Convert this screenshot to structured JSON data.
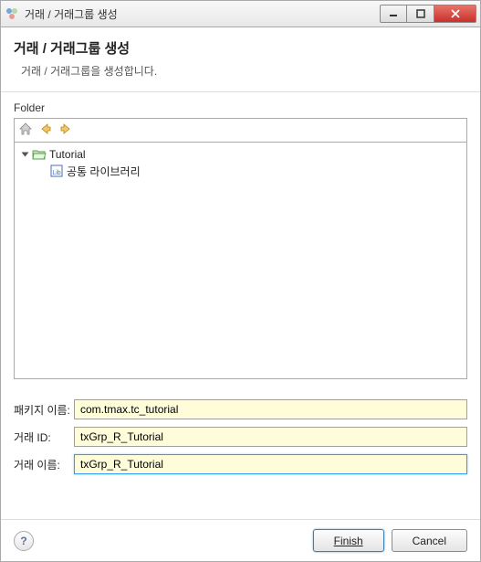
{
  "window": {
    "title": "거래 / 거래그룹 생성"
  },
  "header": {
    "title": "거래 / 거래그룹 생성",
    "subtitle": "거래 / 거래그룹을 생성합니다."
  },
  "folder": {
    "label": "Folder",
    "tree": [
      {
        "level": 0,
        "expanded": true,
        "icon": "folder-open",
        "label": "Tutorial"
      },
      {
        "level": 1,
        "expanded": null,
        "icon": "lib",
        "label": "공통 라이브러리"
      }
    ]
  },
  "form": {
    "package_label": "패키지 이름:",
    "package_value": "com.tmax.tc_tutorial",
    "txid_label": "거래 ID:",
    "txid_value": "txGrp_R_Tutorial",
    "txname_label": "거래 이름:",
    "txname_value": "txGrp_R_Tutorial"
  },
  "footer": {
    "help": "?",
    "finish": "Finish",
    "cancel": "Cancel"
  }
}
